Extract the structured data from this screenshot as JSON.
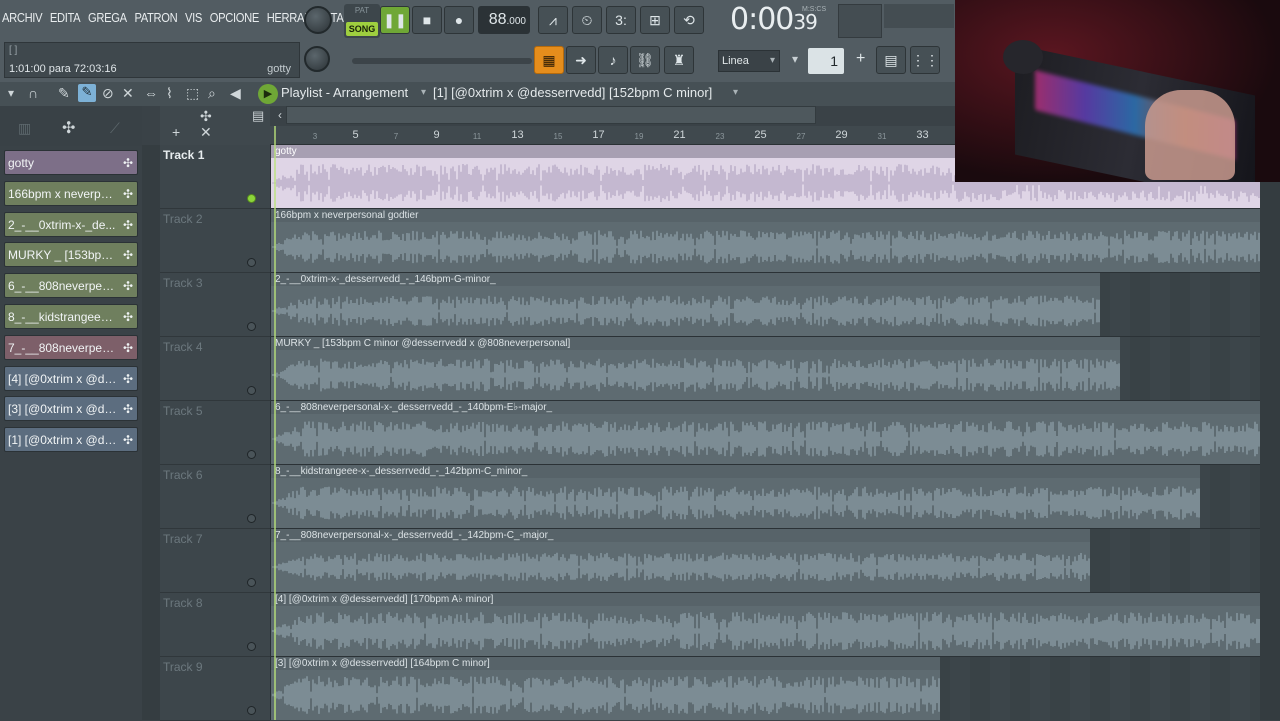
{
  "menu": [
    "ARCHIV",
    "EDITA",
    "GREGA",
    "PATRON",
    "VIS",
    "OPCIONE",
    "HERRAMIENTA"
  ],
  "hint": {
    "top": "[ ]",
    "message": "1:01:00 para 72:03:16",
    "target": "gotty"
  },
  "transport": {
    "pat_label": "PAT",
    "song_label": "SONG",
    "tempo": "88",
    "tempo_decimals": ".000"
  },
  "clock": {
    "time": "0:00",
    "seconds": "39",
    "unit": "M:S:CS"
  },
  "snap": {
    "value": "Linea"
  },
  "stepper": {
    "value": "1"
  },
  "playlist": {
    "title": "Playlist - Arrangement",
    "arrangement": "[1] [@0xtrim x @desserrvedd] [152bpm C minor]"
  },
  "ruler": [
    {
      "label": "3",
      "small": true
    },
    {
      "label": "5",
      "small": false
    },
    {
      "label": "7",
      "small": true
    },
    {
      "label": "9",
      "small": false
    },
    {
      "label": "11",
      "small": true
    },
    {
      "label": "13",
      "small": false
    },
    {
      "label": "15",
      "small": true
    },
    {
      "label": "17",
      "small": false
    },
    {
      "label": "19",
      "small": true
    },
    {
      "label": "21",
      "small": false
    },
    {
      "label": "23",
      "small": true
    },
    {
      "label": "25",
      "small": false
    },
    {
      "label": "27",
      "small": true
    },
    {
      "label": "29",
      "small": false
    },
    {
      "label": "31",
      "small": true
    },
    {
      "label": "33",
      "small": false
    }
  ],
  "picker": [
    {
      "label": "gotty",
      "color": "#7d6f88"
    },
    {
      "label": "166bpm x neverpers...",
      "color": "#6f7f5e"
    },
    {
      "label": "2_-__0xtrim-x-_de...",
      "color": "#6f7f5e"
    },
    {
      "label": "MURKY _ [153bpm C...",
      "color": "#6f7f5e"
    },
    {
      "label": "6_-__808neverpers...",
      "color": "#6f7f5e"
    },
    {
      "label": "8_-__kidstrangeee-...",
      "color": "#6f7f5e"
    },
    {
      "label": "7_-__808neverpers...",
      "color": "#7d5f69"
    },
    {
      "label": "[4] [@0xtrim x @des...",
      "color": "#5c6d7f"
    },
    {
      "label": "[3] [@0xtrim x @des...",
      "color": "#5c6d7f"
    },
    {
      "label": "[1] [@0xtrim x @des...",
      "color": "#5c6d7f"
    }
  ],
  "tracks": [
    {
      "name": "Track 1",
      "clip": "gotty",
      "active": true
    },
    {
      "name": "Track 2",
      "clip": "166bpm x neverpersonal godtier",
      "active": false
    },
    {
      "name": "Track 3",
      "clip": "2_-__0xtrim-x-_desserrvedd_-_146bpm-G-minor_",
      "active": false
    },
    {
      "name": "Track 4",
      "clip": "MURKY _ [153bpm C minor @desserrvedd x @808neverpersonal]",
      "active": false
    },
    {
      "name": "Track 5",
      "clip": "6_-__808neverpersonal-x-_desserrvedd_-_140bpm-E♭-major_",
      "active": false
    },
    {
      "name": "Track 6",
      "clip": "8_-__kidstrangeee-x-_desserrvedd_-_142bpm-C_minor_",
      "active": false
    },
    {
      "name": "Track 7",
      "clip": "7_-__808neverpersonal-x-_desserrvedd_-_142bpm-C_-major_",
      "active": false
    },
    {
      "name": "Track 8",
      "clip": "[4] [@0xtrim x @desserrvedd] [170bpm A♭ minor]",
      "active": false
    },
    {
      "name": "Track 9",
      "clip": "[3] [@0xtrim x @desserrvedd] [164bpm C minor]",
      "active": false
    }
  ]
}
